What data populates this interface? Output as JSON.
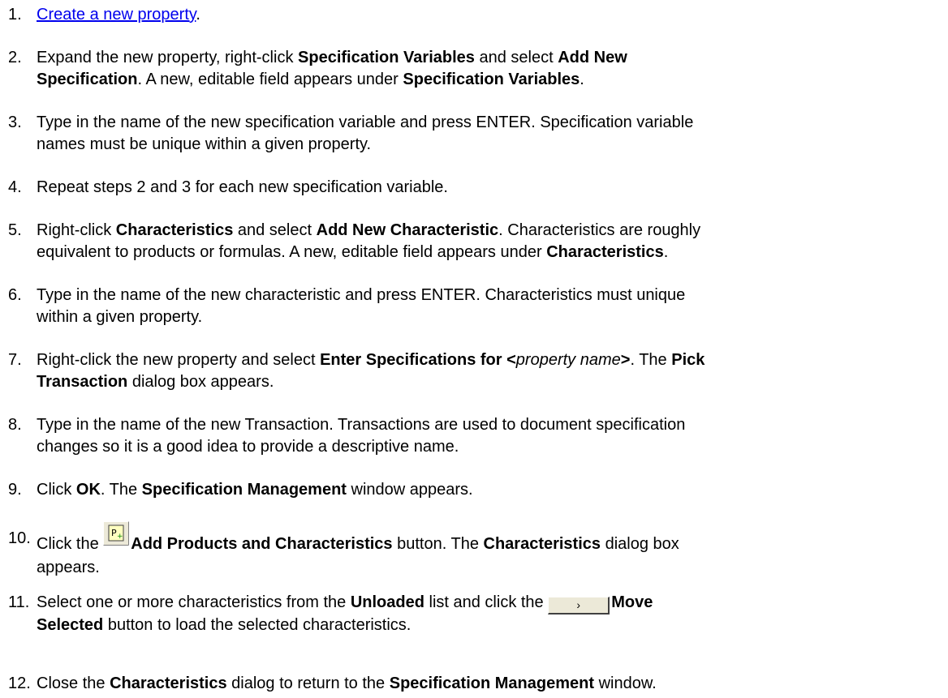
{
  "steps": [
    {
      "num": "1.",
      "link": "Create a new property",
      "after": "."
    },
    {
      "num": "2.",
      "t1": "Expand the new property, right-click ",
      "b1": "Specification Variables",
      "t2": " and select ",
      "b2": "Add New",
      "b2b": "Specification",
      "t3": ". A new, editable field appears under ",
      "b3": "Specification Variables",
      "t4": "."
    },
    {
      "num": "3.",
      "line1": "Type in the name of the new specification variable and press ENTER. Specification variable",
      "line2": "names must be unique within a given property."
    },
    {
      "num": "4.",
      "line1": "Repeat steps 2 and 3 for each new specification variable."
    },
    {
      "num": "5.",
      "t1": "Right-click ",
      "b1": "Characteristics",
      "t2": " and select ",
      "b2": "Add New Characteristic",
      "t3": ". Characteristics are roughly",
      "line2a": "equivalent to products or formulas. A new, editable field appears under ",
      "b3": "Characteristics",
      "t4": "."
    },
    {
      "num": "6.",
      "line1": "Type in the name of the new characteristic and press ENTER. Characteristics must unique",
      "line2": "within a given property."
    },
    {
      "num": "7.",
      "t1": "Right-click the new property and select ",
      "b1": "Enter Specifications for <",
      "i1": "property name",
      "b1b": ">",
      "t2": ". The ",
      "b2": "Pick",
      "b2b": "Transaction",
      "t3": " dialog box appears."
    },
    {
      "num": "8.",
      "line1": "Type in the name of the new Transaction. Transactions are used to document specification",
      "line2": "changes so it is a good idea to provide a descriptive name."
    },
    {
      "num": "9.",
      "t1": "Click ",
      "b1": "OK",
      "t2": ". The ",
      "b2": "Specification Management",
      "t3": " window appears."
    },
    {
      "num": "10.",
      "t1": "Click the ",
      "b1": "Add Products and Characteristics",
      "t2": " button. The ",
      "b2": "Characteristics",
      "t3": " dialog box",
      "line2": "appears."
    },
    {
      "num": "11.",
      "t1": "Select one or more characteristics from the ",
      "b1": "Unloaded",
      "t2": " list and click the ",
      "btn": "›",
      "b2": "Move",
      "b2b": "Selected",
      "t3": " button to load the selected characteristics."
    },
    {
      "num": "12.",
      "t1": "Close the ",
      "b1": "Characteristics",
      "t2": " dialog to return to the ",
      "b2": "Specification Management",
      "t3": " window."
    }
  ],
  "icons": {
    "add_products": "add-products-icon",
    "move_selected": "move-selected-icon"
  }
}
